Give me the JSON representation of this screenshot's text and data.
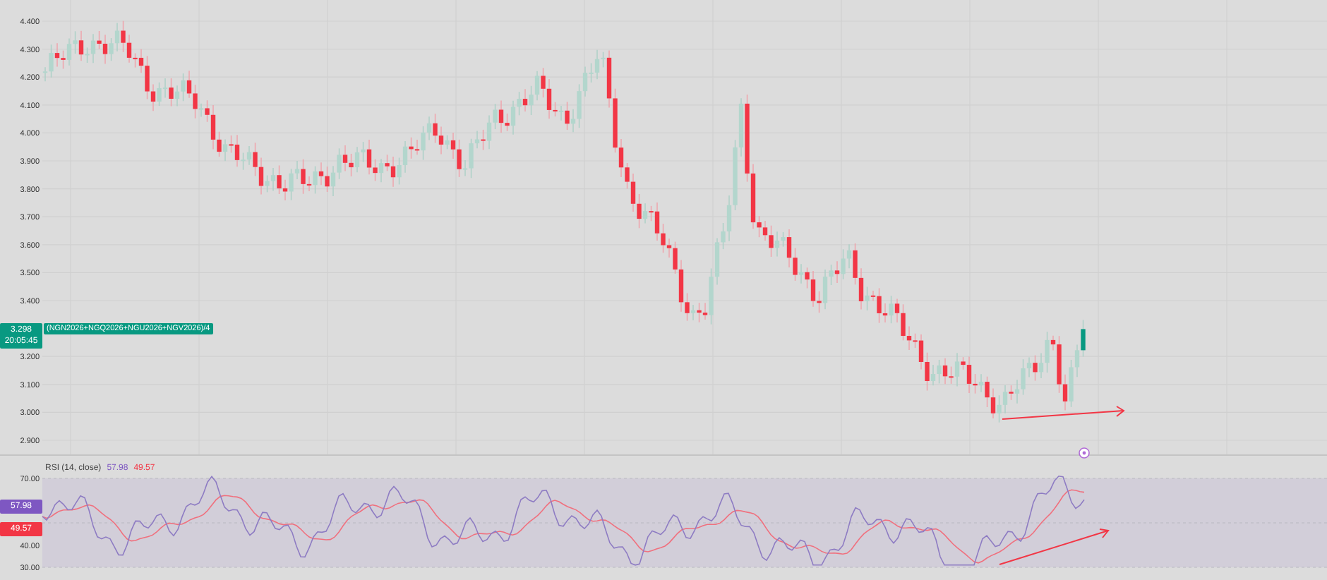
{
  "price_axis": {
    "ticks": [
      "4.400",
      "4.300",
      "4.200",
      "4.100",
      "4.000",
      "3.900",
      "3.800",
      "3.700",
      "3.600",
      "3.500",
      "3.400",
      "3.200",
      "3.100",
      "3.000",
      "2.900"
    ]
  },
  "price_badge": {
    "price": "3.298",
    "countdown": "20:05:45"
  },
  "symbol_label": "(NGN2026+NGQ2026+NGU2026+NGV2026)/4",
  "rsi": {
    "title": "RSI (14, close)",
    "legend_values": [
      {
        "text": "57.98",
        "color": "#7e57c2"
      },
      {
        "text": "49.57",
        "color": "#f23645"
      }
    ],
    "ticks": [
      "70.00",
      "40.00",
      "30.00"
    ],
    "badges": [
      {
        "text": "57.98",
        "color": "#7e57c2"
      },
      {
        "text": "49.57",
        "color": "#f23645"
      }
    ]
  }
}
